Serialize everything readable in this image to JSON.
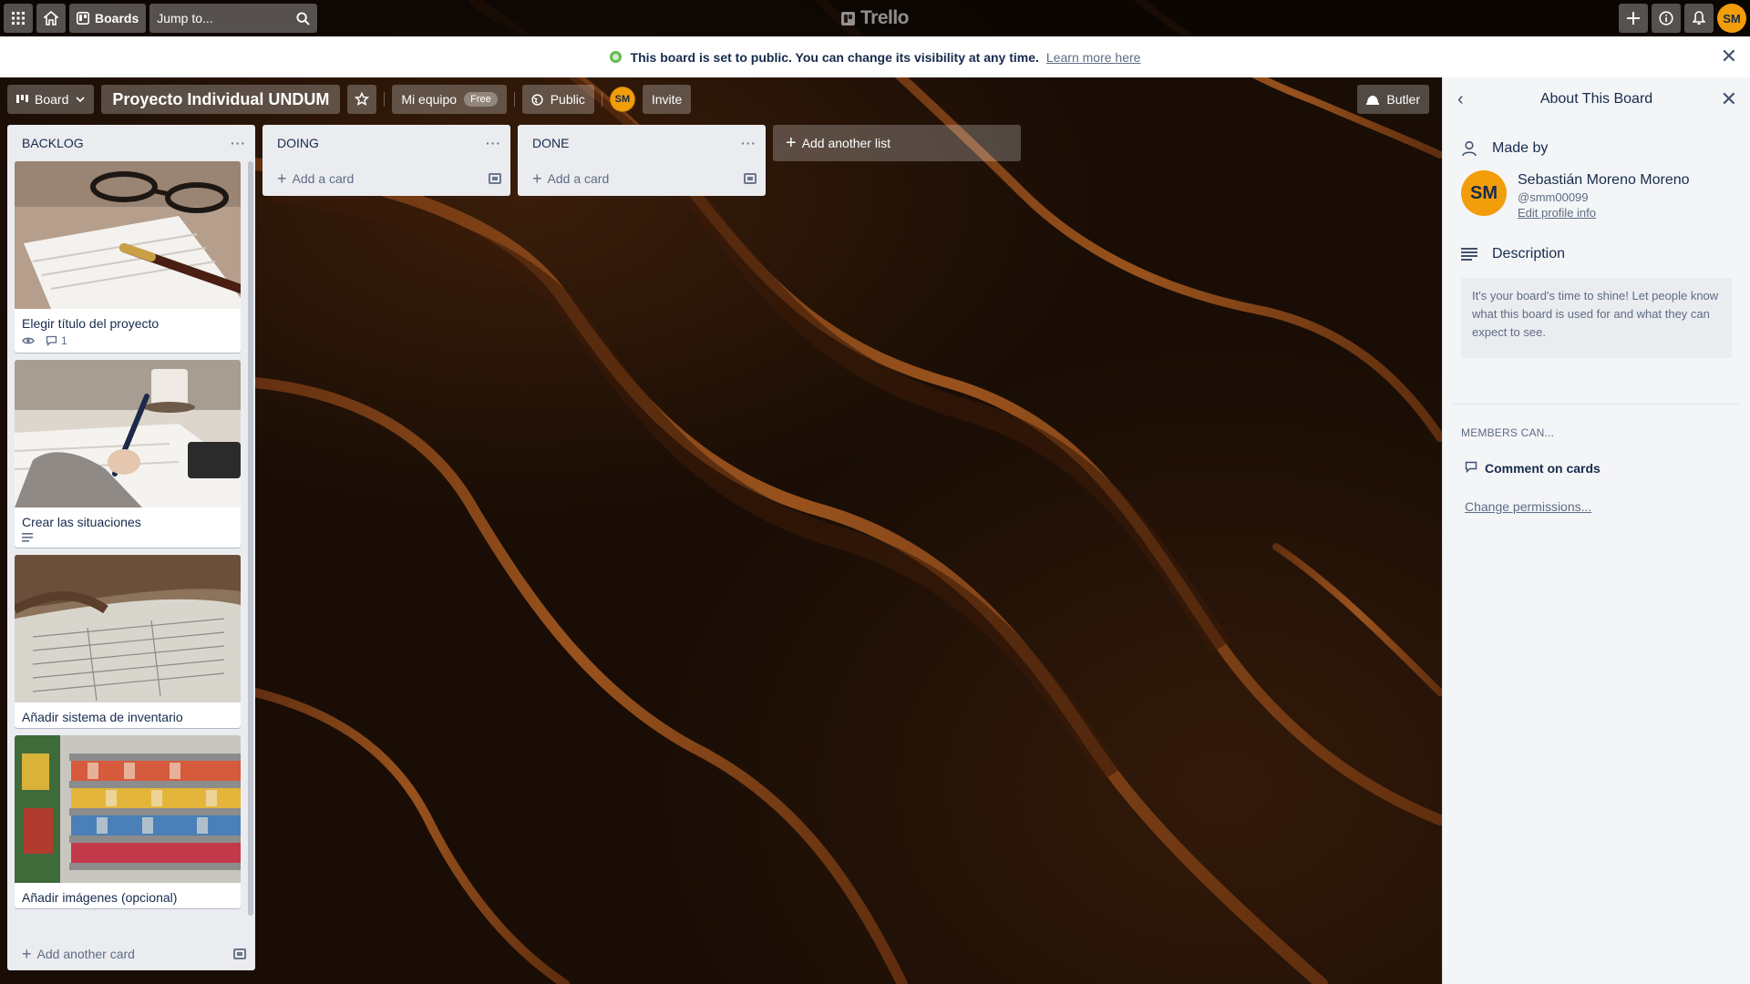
{
  "topbar": {
    "boards_label": "Boards",
    "search_placeholder": "Jump to...",
    "logo_text": "Trello",
    "user_initials": "SM"
  },
  "notice": {
    "message": "This board is set to public. You can change its visibility at any time.",
    "link": "Learn more here"
  },
  "board_header": {
    "view_label": "Board",
    "title": "Proyecto Individual UNDUM",
    "team_label": "Mi equipo",
    "team_badge": "Free",
    "visibility_label": "Public",
    "member_initials": "SM",
    "invite_label": "Invite",
    "butler_label": "Butler"
  },
  "lists": [
    {
      "name": "BACKLOG",
      "cards": [
        {
          "title": "Elegir título del proyecto",
          "watch": true,
          "comments": "1"
        },
        {
          "title": "Crear las situaciones",
          "has_description": true
        },
        {
          "title": "Añadir sistema de inventario"
        },
        {
          "title": "Añadir imágenes (opcional)"
        }
      ],
      "add_label": "Add another card"
    },
    {
      "name": "DOING",
      "add_label": "Add a card"
    },
    {
      "name": "DONE",
      "add_label": "Add a card"
    }
  ],
  "add_list_label": "Add another list",
  "sidebar": {
    "title": "About This Board",
    "made_by_label": "Made by",
    "creator": {
      "initials": "SM",
      "name": "Sebastián Moreno Moreno",
      "handle": "@smm00099",
      "edit_link": "Edit profile info"
    },
    "description_label": "Description",
    "description_placeholder": "It's your board's time to shine! Let people know what this board is used for and what they can expect to see.",
    "members_can_label": "MEMBERS CAN...",
    "permission": "Comment on cards",
    "change_link": "Change permissions..."
  },
  "colors": {
    "accent_orange": "#f29d0a",
    "list_bg": "#ebecf0",
    "public_green": "#61bd4f"
  }
}
